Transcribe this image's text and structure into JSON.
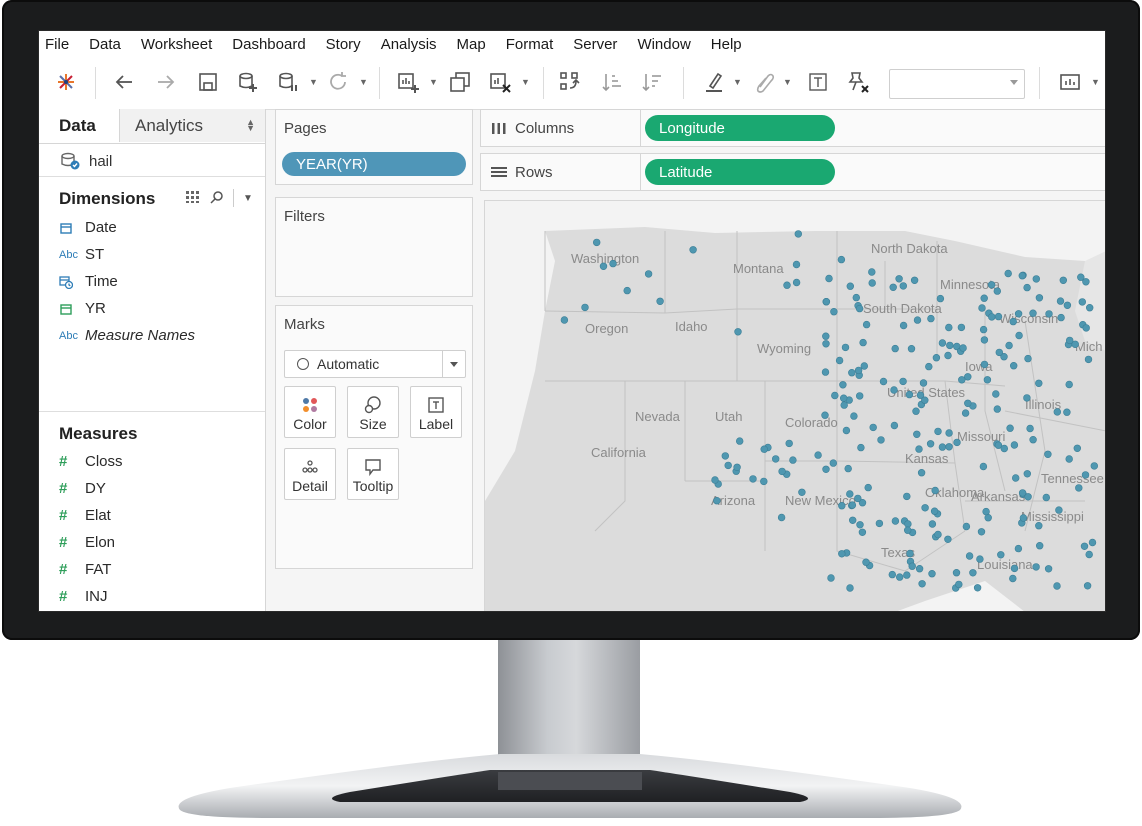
{
  "menu": [
    "File",
    "Data",
    "Worksheet",
    "Dashboard",
    "Story",
    "Analysis",
    "Map",
    "Format",
    "Server",
    "Window",
    "Help"
  ],
  "toolbar": {
    "icons": [
      "tableau-logo-icon",
      "undo-icon",
      "redo-icon",
      "save-icon",
      "new-data-source-icon",
      "pause-updates-icon",
      "refresh-icon",
      "new-worksheet-icon",
      "duplicate-sheet-icon",
      "clear-sheet-icon",
      "swap-rows-columns-icon",
      "sort-ascending-icon",
      "sort-descending-icon",
      "highlight-icon",
      "group-icon",
      "show-labels-icon",
      "fix-axes-icon",
      "fit-dropdown",
      "show-me-icon"
    ]
  },
  "datapane": {
    "tab_data": "Data",
    "tab_analytics": "Analytics",
    "datasource": "hail",
    "dimensions_title": "Dimensions",
    "dimensions": [
      {
        "type": "date",
        "label": "Date",
        "italic": false
      },
      {
        "type": "abc",
        "label": "ST",
        "italic": false
      },
      {
        "type": "datetime",
        "label": "Time",
        "italic": false
      },
      {
        "type": "date",
        "label": "YR",
        "italic": false
      },
      {
        "type": "abc",
        "label": "Measure Names",
        "italic": true
      }
    ],
    "type_abc_label": "Abc",
    "measures_title": "Measures",
    "measures": [
      "Closs",
      "DY",
      "Elat",
      "Elon",
      "FAT",
      "INJ"
    ],
    "measure_icon": "#"
  },
  "cards": {
    "pages_title": "Pages",
    "pages_pill": "YEAR(YR)",
    "filters_title": "Filters",
    "marks_title": "Marks",
    "marks_type": "Automatic",
    "marks_buttons": [
      "Color",
      "Size",
      "Label",
      "Detail",
      "Tooltip"
    ]
  },
  "shelves": {
    "columns_label": "Columns",
    "columns_pill": "Longitude",
    "rows_label": "Rows",
    "rows_pill": "Latitude"
  },
  "map": {
    "state_labels": [
      "Washington",
      "Montana",
      "North Dakota",
      "Minnesota",
      "Oregon",
      "Idaho",
      "South Dakota",
      "Wisconsin",
      "Wyoming",
      "Mich",
      "Iowa",
      "Nevada",
      "Utah",
      "Colorado",
      "United States",
      "Illinois",
      "Missouri",
      "California",
      "Kansas",
      "Tennessee",
      "Arizona",
      "New Mexico",
      "Oklahoma",
      "Arkansas",
      "Mississippi",
      "Texas",
      "Louisiana"
    ],
    "point_color": "#4f97b0",
    "point_count": 250
  }
}
